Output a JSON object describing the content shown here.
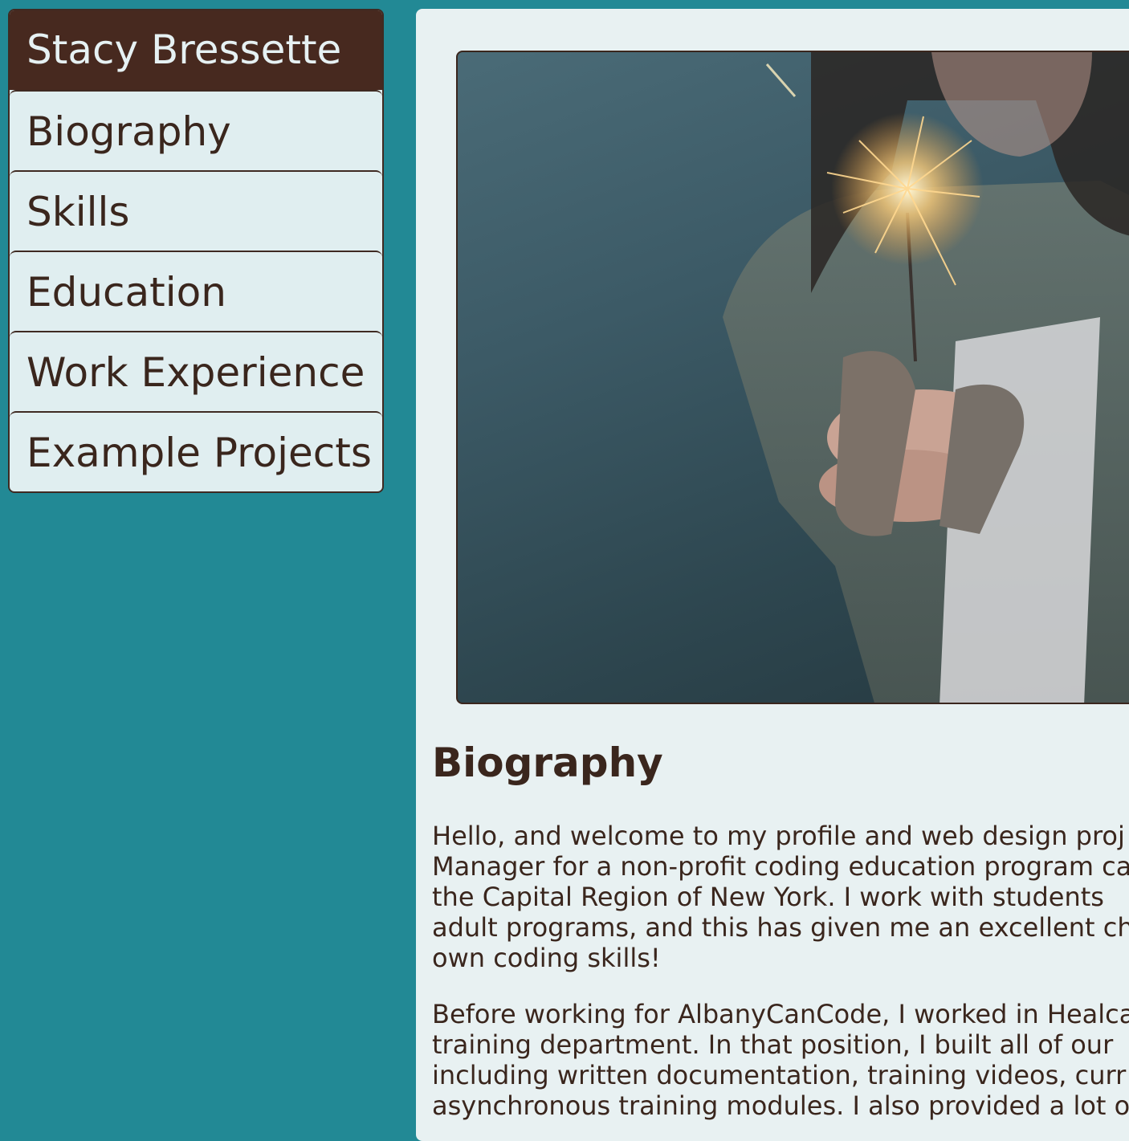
{
  "sidebar": {
    "title": "Stacy Bressette",
    "items": [
      {
        "label": "Biography"
      },
      {
        "label": "Skills"
      },
      {
        "label": "Education"
      },
      {
        "label": "Work Experience"
      },
      {
        "label": "Example Projects"
      }
    ]
  },
  "main": {
    "heading": "Biography",
    "paragraph1": [
      "Hello, and welcome to my profile and web design proj",
      "Manager for a non-profit coding education program ca",
      "the Capital Region of New York. I work with students",
      "adult programs, and this has given me an excellent ch",
      "own coding skills!"
    ],
    "paragraph2": [
      "Before working for AlbanyCanCode, I worked in Healca",
      "training department. In that position, I built all of our",
      "including written documentation, training videos, curr",
      "asynchronous training modules. I also provided a lot o"
    ]
  },
  "colors": {
    "page_background": "#228995",
    "nav_title_background": "#47291f",
    "nav_item_background": "#e0eef0",
    "text": "#3a261d",
    "panel_background": "#e8f1f2"
  }
}
